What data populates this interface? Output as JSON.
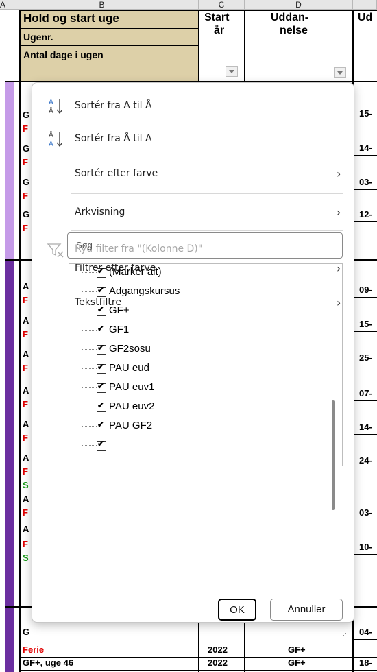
{
  "columns": {
    "a": "A",
    "b": "B",
    "c": "C",
    "d": "D"
  },
  "header": {
    "b_title": "Hold og start uge",
    "b_week": "Ugenr.",
    "b_days": "Antal dage i ugen",
    "c_line1": "Start",
    "c_line2": "år",
    "d_line1": "Uddan-",
    "d_line2": "nelse",
    "e_partial": "Ud"
  },
  "colors": {
    "band_light": "#c59be8",
    "band_dark": "#6b2fa0",
    "header_fill": "#ddd0a8",
    "red_text": "#e00000",
    "green_text": "#1a9a1a"
  },
  "left_letters": [
    {
      "t": "G",
      "c": "black"
    },
    {
      "t": "F",
      "c": "red"
    },
    {
      "t": "G",
      "c": "black"
    },
    {
      "t": "F",
      "c": "red"
    },
    {
      "t": "G",
      "c": "black"
    },
    {
      "t": "F",
      "c": "red"
    },
    {
      "t": "G",
      "c": "black"
    },
    {
      "t": "F",
      "c": "red"
    },
    {
      "t": "A",
      "c": "black"
    },
    {
      "t": "F",
      "c": "red"
    },
    {
      "t": "A",
      "c": "black"
    },
    {
      "t": "F",
      "c": "red"
    },
    {
      "t": "A",
      "c": "black"
    },
    {
      "t": "F",
      "c": "red"
    },
    {
      "t": "A",
      "c": "black"
    },
    {
      "t": "F",
      "c": "red"
    },
    {
      "t": "A",
      "c": "black"
    },
    {
      "t": "F",
      "c": "red"
    },
    {
      "t": "A",
      "c": "black"
    },
    {
      "t": "F",
      "c": "red"
    },
    {
      "t": "S",
      "c": "green"
    },
    {
      "t": "A",
      "c": "black"
    },
    {
      "t": "F",
      "c": "red"
    },
    {
      "t": "A",
      "c": "black"
    },
    {
      "t": "F",
      "c": "red"
    },
    {
      "t": "S",
      "c": "green"
    },
    {
      "t": "G",
      "c": "black"
    }
  ],
  "right_values": [
    "15-",
    "14-",
    "03-",
    "12-",
    "09-",
    "15-",
    "25-",
    "07-",
    "14-",
    "24-",
    "03-",
    "10-",
    "04-",
    "18-"
  ],
  "bottom_rows": [
    {
      "b": "Ferie",
      "c": "2022",
      "d": "GF+",
      "e": ""
    },
    {
      "b": "GF+, uge 46",
      "c": "2022",
      "d": "GF+",
      "e": "18-"
    }
  ],
  "menu": {
    "sort_az": "Sortér fra A til Å",
    "sort_za": "Sortér fra Å til A",
    "sort_color": "Sortér efter farve",
    "sheet_view": "Arkvisning",
    "clear_filter": "Ryd filter fra \"(Kolonne D)\"",
    "filter_color": "Filtrer efter farve",
    "text_filters": "Tekstfiltre",
    "search_placeholder": "Søg",
    "items": [
      "(Markér alt)",
      "Adgangskursus",
      "GF+",
      "GF1",
      "GF2sosu",
      "PAU eud",
      "PAU euv1",
      "PAU euv2",
      "PAU GF2"
    ],
    "ok": "OK",
    "cancel": "Annuller"
  }
}
